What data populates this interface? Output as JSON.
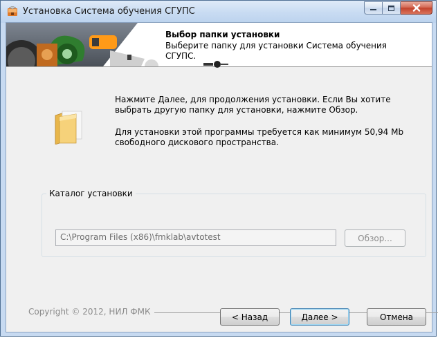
{
  "window": {
    "title": "Установка Система обучения СГУПС",
    "icon": "installer-icon"
  },
  "header": {
    "title": "Выбор папки установки",
    "subtitle": "Выберите папку для установки Система обучения СГУПС."
  },
  "body": {
    "paragraph1": "Нажмите Далее, для продолжения установки. Если Вы хотите выбрать другую папку для установки, нажмите Обзор.",
    "paragraph2": "Для установки этой программы требуется как минимум 50,94 Mb свободного дискового пространства.",
    "folder_icon": "folder-icon"
  },
  "install_dir": {
    "group_label": "Каталог установки",
    "path": "C:\\Program Files (x86)\\fmklab\\avtotest",
    "browse_label": "Обзор..."
  },
  "footer": {
    "copyright": "Copyright © 2012, НИЛ ФМК",
    "back_label": "< Назад",
    "next_label": "Далее >",
    "cancel_label": "Отмена"
  },
  "colors": {
    "titlebar": "#c8dbf2",
    "close_button": "#c2432c",
    "default_button_border": "#3c7fb1"
  }
}
